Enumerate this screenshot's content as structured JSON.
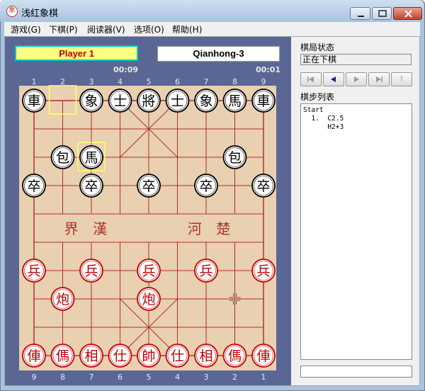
{
  "window": {
    "title": "浅红象棋",
    "icon": "xiangqi-app-icon"
  },
  "title_buttons": [
    "minimize-icon",
    "maximize-icon",
    "close-icon"
  ],
  "menu": [
    "游戏(G)",
    "下棋(P)",
    "阅读器(V)",
    "选项(O)",
    "帮助(H)"
  ],
  "players": {
    "red": {
      "name": "Player 1",
      "time": "00:09"
    },
    "black": {
      "name": "Qianhong-3",
      "time": "00:01"
    }
  },
  "board": {
    "top_files": [
      "1",
      "2",
      "3",
      "4",
      "5",
      "6",
      "7",
      "8",
      "9"
    ],
    "bottom_files": [
      "9",
      "8",
      "7",
      "6",
      "5",
      "4",
      "3",
      "2",
      "1"
    ],
    "river_left": [
      "界",
      "漢"
    ],
    "river_right": [
      "河",
      "楚"
    ],
    "colors": {
      "board": "#e8d0b0",
      "line": "#b03030",
      "frame": "#5a6794",
      "black_piece": "#000000",
      "red_piece": "#c00000",
      "highlight": "#ffff66"
    },
    "pieces": [
      {
        "ch": "車",
        "side": "black",
        "file": 0,
        "rank": 0
      },
      {
        "ch": "象",
        "side": "black",
        "file": 2,
        "rank": 0
      },
      {
        "ch": "士",
        "side": "black",
        "file": 3,
        "rank": 0
      },
      {
        "ch": "將",
        "side": "black",
        "file": 4,
        "rank": 0
      },
      {
        "ch": "士",
        "side": "black",
        "file": 5,
        "rank": 0
      },
      {
        "ch": "象",
        "side": "black",
        "file": 6,
        "rank": 0
      },
      {
        "ch": "馬",
        "side": "black",
        "file": 7,
        "rank": 0
      },
      {
        "ch": "車",
        "side": "black",
        "file": 8,
        "rank": 0
      },
      {
        "ch": "包",
        "side": "black",
        "file": 1,
        "rank": 2
      },
      {
        "ch": "馬",
        "side": "black",
        "file": 2,
        "rank": 2
      },
      {
        "ch": "包",
        "side": "black",
        "file": 7,
        "rank": 2
      },
      {
        "ch": "卒",
        "side": "black",
        "file": 0,
        "rank": 3
      },
      {
        "ch": "卒",
        "side": "black",
        "file": 2,
        "rank": 3
      },
      {
        "ch": "卒",
        "side": "black",
        "file": 4,
        "rank": 3
      },
      {
        "ch": "卒",
        "side": "black",
        "file": 6,
        "rank": 3
      },
      {
        "ch": "卒",
        "side": "black",
        "file": 8,
        "rank": 3
      },
      {
        "ch": "兵",
        "side": "red",
        "file": 0,
        "rank": 6
      },
      {
        "ch": "兵",
        "side": "red",
        "file": 2,
        "rank": 6
      },
      {
        "ch": "兵",
        "side": "red",
        "file": 4,
        "rank": 6
      },
      {
        "ch": "兵",
        "side": "red",
        "file": 6,
        "rank": 6
      },
      {
        "ch": "兵",
        "side": "red",
        "file": 8,
        "rank": 6
      },
      {
        "ch": "炮",
        "side": "red",
        "file": 1,
        "rank": 7
      },
      {
        "ch": "炮",
        "side": "red",
        "file": 4,
        "rank": 7
      },
      {
        "ch": "俥",
        "side": "red",
        "file": 0,
        "rank": 9
      },
      {
        "ch": "傌",
        "side": "red",
        "file": 1,
        "rank": 9
      },
      {
        "ch": "相",
        "side": "red",
        "file": 2,
        "rank": 9
      },
      {
        "ch": "仕",
        "side": "red",
        "file": 3,
        "rank": 9
      },
      {
        "ch": "帥",
        "side": "red",
        "file": 4,
        "rank": 9
      },
      {
        "ch": "仕",
        "side": "red",
        "file": 5,
        "rank": 9
      },
      {
        "ch": "相",
        "side": "red",
        "file": 6,
        "rank": 9
      },
      {
        "ch": "傌",
        "side": "red",
        "file": 7,
        "rank": 9
      },
      {
        "ch": "俥",
        "side": "red",
        "file": 8,
        "rank": 9
      }
    ],
    "highlights": [
      {
        "file": 1,
        "rank": 0
      },
      {
        "file": 2,
        "rank": 2
      }
    ],
    "cursor": {
      "file": 7,
      "rank": 7
    }
  },
  "status": {
    "label": "棋局状态",
    "value": "正在下棋"
  },
  "nav_buttons": [
    "first-move-icon",
    "prev-move-icon",
    "next-move-icon",
    "last-move-icon"
  ],
  "nav_alert": "!",
  "moves": {
    "label": "棋步列表",
    "lines": [
      "Start",
      "  1.  C2.5",
      "      H2+3"
    ]
  }
}
